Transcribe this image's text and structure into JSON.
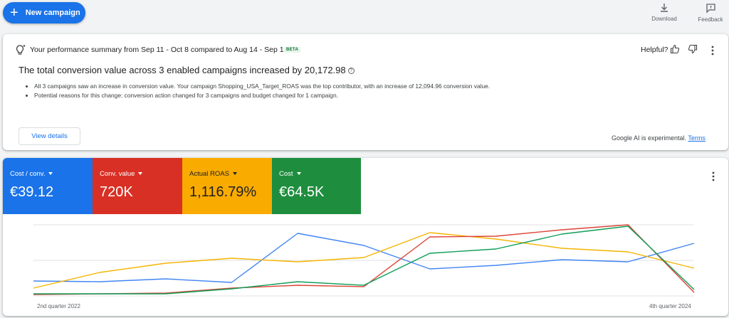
{
  "toolbar": {
    "new_campaign_label": "New campaign",
    "download_label": "Download",
    "feedback_label": "Feedback"
  },
  "summary": {
    "heading": "Your performance summary from Sep 11 - Oct 8 compared to Aug 14 - Sep 10",
    "badge": "BETA",
    "helpful_label": "Helpful?",
    "headline": "The total conversion value across 3 enabled campaigns increased by 20,172.98",
    "bullets": [
      "All 3 campaigns saw an increase in conversion value. Your campaign Shopping_USA_Target_ROAS was the top contributor, with an increase of 12,094.96 conversion value.",
      "Potential reasons for this change: conversion action changed for 3 campaigns and budget changed for 1 campaign."
    ],
    "view_details_label": "View details",
    "experimental_text": "Google AI is experimental.",
    "terms_label": "Terms"
  },
  "metrics": [
    {
      "label": "Cost / conv.",
      "value": "€39.12",
      "color": "#1a73e8"
    },
    {
      "label": "Conv. value",
      "value": "720K",
      "color": "#d93025"
    },
    {
      "label": "Actual ROAS",
      "value": "1,116.79%",
      "color": "#f9ab00"
    },
    {
      "label": "Cost",
      "value": "€64.5K",
      "color": "#1e8e3e"
    }
  ],
  "chart_data": {
    "type": "line",
    "x_start_label": "2nd quarter 2022",
    "x_end_label": "4th quarter 2024",
    "x": [
      0,
      1,
      2,
      3,
      4,
      5,
      6,
      7,
      8,
      9,
      10
    ],
    "ylim": [
      0,
      100
    ],
    "series": [
      {
        "color": "#4285f4",
        "values": [
          21,
          20,
          24,
          19,
          88,
          71,
          38,
          43,
          51,
          48,
          74
        ]
      },
      {
        "color": "#f4b400",
        "values": [
          11,
          33,
          46,
          53,
          48,
          54,
          89,
          80,
          67,
          62,
          39
        ]
      },
      {
        "color": "#db4437",
        "values": [
          2,
          3,
          4,
          11,
          15,
          13,
          83,
          84,
          93,
          100,
          5
        ]
      },
      {
        "color": "#0f9d58",
        "values": [
          3,
          3,
          3,
          10,
          20,
          15,
          60,
          66,
          87,
          98,
          9
        ]
      }
    ]
  }
}
